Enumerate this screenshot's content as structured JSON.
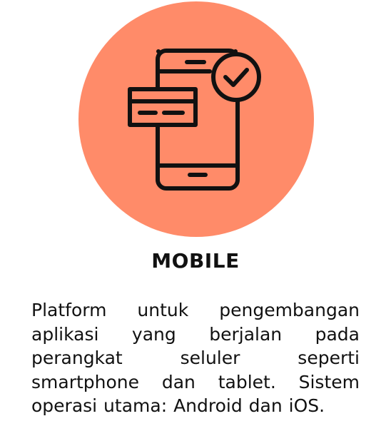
{
  "card": {
    "icon": "smartphone-with-card-and-checkmark-icon",
    "badge_color": "#ff8b69",
    "title": "MOBILE",
    "description": "Platform untuk pengembangan aplikasi yang berjalan pada perangkat seluler seperti smartphone dan tablet. Sistem operasi utama: Android dan iOS."
  }
}
